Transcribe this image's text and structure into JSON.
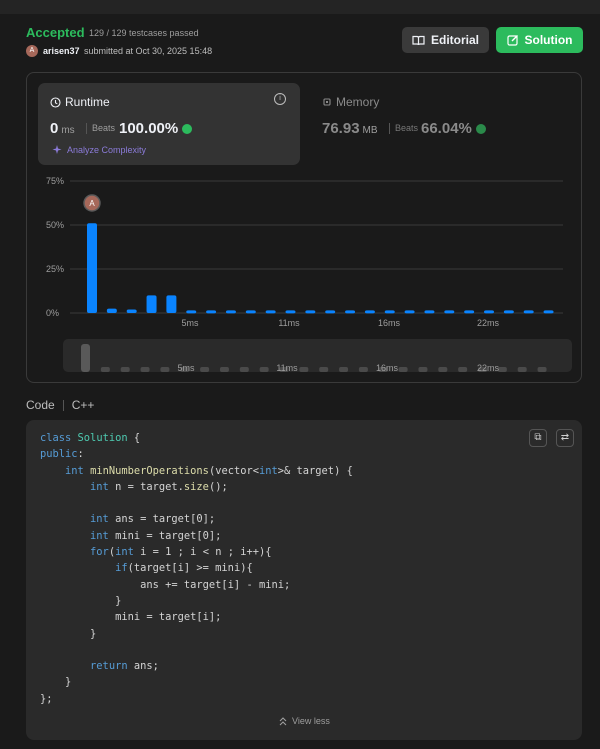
{
  "header": {
    "status": "Accepted",
    "passed": "129 / 129 testcases passed",
    "avatar_letter": "A",
    "username": "arisen37",
    "submitted_at": "submitted at Oct 30, 2025 15:48",
    "editorial_label": "Editorial",
    "solution_label": "Solution"
  },
  "runtime": {
    "label": "Runtime",
    "value": "0",
    "unit": "ms",
    "beats_label": "Beats",
    "beats_value": "100.00%",
    "analyze_label": "Analyze Complexity"
  },
  "memory": {
    "label": "Memory",
    "value": "76.93",
    "unit": "MB",
    "beats_label": "Beats",
    "beats_value": "66.04%"
  },
  "chart_data": {
    "type": "bar",
    "yticks": [
      "75%",
      "50%",
      "25%",
      "0%"
    ],
    "ylim": [
      0,
      75
    ],
    "xtick_labels": [
      "5ms",
      "11ms",
      "16ms",
      "22ms"
    ],
    "values": [
      51,
      2.5,
      2,
      10,
      10,
      1.5,
      1.5,
      1.5,
      1.5,
      1.5,
      1.5,
      1.5,
      1.5,
      1.5,
      1.5,
      1.5,
      1.5,
      1.5,
      1.5,
      1.5,
      1.5,
      1.5,
      1.5,
      1.5
    ],
    "marker_letter": "A",
    "bar_color": "#0a84ff",
    "grid": true
  },
  "code": {
    "label": "Code",
    "language": "C++",
    "lines": [
      "class Solution {",
      "public:",
      "    int minNumberOperations(vector<int>& target) {",
      "        int n = target.size();",
      "",
      "        int ans = target[0];",
      "        int mini = target[0];",
      "        for(int i = 1 ; i < n ; i++){",
      "            if(target[i] >= mini){",
      "                ans += target[i] - mini;",
      "            }",
      "            mini = target[i];",
      "        }",
      "",
      "        return ans;",
      "    }",
      "};"
    ],
    "view_less": "View less"
  }
}
